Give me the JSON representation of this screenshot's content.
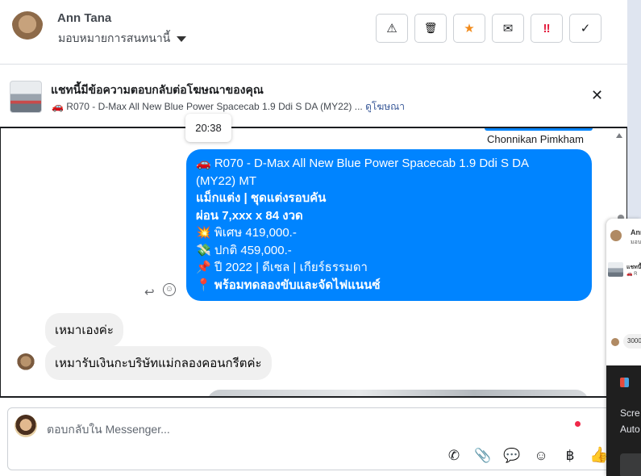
{
  "header": {
    "user_name": "Ann Tana",
    "assign_label": "มอบหมายการสนทนานี้",
    "tools": [
      {
        "name": "report",
        "icon": "warning-icon",
        "glyph": "⚠"
      },
      {
        "name": "delete",
        "icon": "trash-icon",
        "glyph": "🗑"
      },
      {
        "name": "star",
        "icon": "star-icon",
        "glyph": "★"
      },
      {
        "name": "mark-unread",
        "icon": "envelope-icon",
        "glyph": "✉"
      },
      {
        "name": "follow-up",
        "icon": "exclamation-icon",
        "glyph": "‼"
      },
      {
        "name": "done",
        "icon": "check-icon",
        "glyph": "✓"
      }
    ]
  },
  "ad_context": {
    "title": "แชทนี้มีข้อความตอบกลับต่อโฆษณาของคุณ",
    "subtitle": "🚗 R070 - D-Max All New Blue Power Spacecab 1.9 Ddi S DA (MY22) ...",
    "link": "ดูโฆษณา",
    "close_glyph": "✕"
  },
  "conversation": {
    "time_tooltip": "20:38",
    "sender_name": "Chonnikan Pimkham",
    "outgoing_lines": [
      "🚗 R070 - D-Max All New Blue Power Spacecab 1.9 Ddi S DA",
      "(MY22) MT",
      "แม็กแต่ง | ชุดแต่งรอบคัน",
      "ผ่อน 7,xxx x 84 งวด",
      "💥 พิเศษ 419,000.-",
      "💸 ปกติ 459,000.-",
      "📌 ปี 2022 | ดีเซล | เกียร์ธรรมดา",
      "📍 พร้อมทดลองขับและจัดไฟแนนซ์"
    ],
    "reply_glyph": "↩",
    "react_glyph": "☺",
    "incoming": [
      {
        "text": "เหมาเองค่ะ"
      },
      {
        "text": "เหมารับเงินกะบริษัทแม่กลองคอนกรีตค่ะ"
      }
    ]
  },
  "composer": {
    "placeholder": "ตอบกลับใน Messenger...",
    "icons": [
      {
        "name": "call-add-icon",
        "glyph": "✆"
      },
      {
        "name": "attachment-icon",
        "glyph": "📎"
      },
      {
        "name": "saved-replies-icon",
        "glyph": "💬"
      },
      {
        "name": "emoji-icon",
        "glyph": "☺"
      },
      {
        "name": "baht-icon",
        "glyph": "฿"
      }
    ],
    "like_glyph": "👍"
  },
  "side_panel": {
    "name": "Ann",
    "sub": "มอบ",
    "ad_title": "แชทนี้",
    "ad_sub": "🚗 R",
    "pill_text": "3000",
    "dark_text_1": "Scre",
    "dark_text_2": "Auto"
  }
}
